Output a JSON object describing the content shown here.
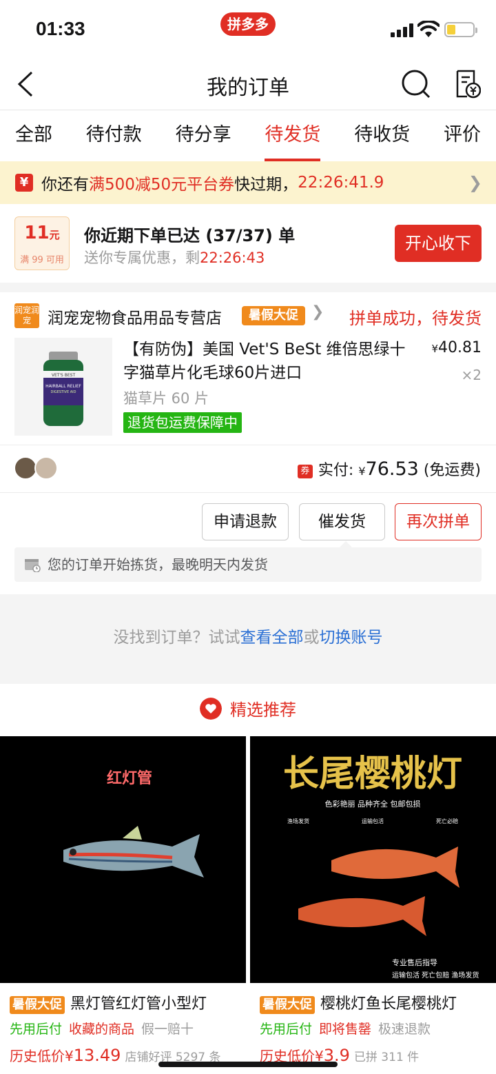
{
  "status_bar": {
    "time": "01:33",
    "brand_badge": "拼多多"
  },
  "nav": {
    "title": "我的订单"
  },
  "tabs": [
    {
      "label": "全部",
      "active": false
    },
    {
      "label": "待付款",
      "active": false
    },
    {
      "label": "待分享",
      "active": false
    },
    {
      "label": "待发货",
      "active": true
    },
    {
      "label": "待收货",
      "active": false
    },
    {
      "label": "评价",
      "active": false
    }
  ],
  "coupon_banner": {
    "prefix": "你还有",
    "highlight": "满500减50元平台券",
    "suffix": "快过期，",
    "countdown": "22:26:41.9"
  },
  "promo": {
    "coupon_amount": "11",
    "coupon_unit": "元",
    "coupon_condition": "满 99 可用",
    "headline": "你近期下单已达 (37/37) 单",
    "sub_prefix": "送你专属优惠，剩",
    "sub_timer": "22:26:43",
    "button_label": "开心收下"
  },
  "order": {
    "shop_logo_text": "润宠润宠",
    "shop_name": "润宠宠物食品用品专营店",
    "shop_tag": "暑假大促",
    "status": "拼单成功，待发货",
    "item_title": "【有防伪】美国 Vet'S BeSt 维倍思绿十字猫草片化毛球60片进口",
    "item_price": "40.81",
    "item_currency": "¥",
    "item_qty": "×2",
    "item_spec": "猫草片 60 片",
    "guarantee": "退货包运费保障中",
    "pay_coupon_icon": "券",
    "pay_label": "实付:",
    "pay_currency": "¥",
    "pay_amount": "76.53",
    "pay_note": "(免运费)",
    "actions": [
      "申请退款",
      "催发货",
      "再次拼单"
    ],
    "notice": "您的订单开始拣货，最晚明天内发货"
  },
  "empty_hint": {
    "prefix": "没找到订单？试试",
    "link1": "查看全部",
    "middle": "或",
    "link2": "切换账号"
  },
  "recommend": {
    "title": "精选推荐",
    "cards": [
      {
        "image_text": "红灯管",
        "tag": "暑假大促",
        "title": "黑灯管红灯管小型灯",
        "badge": "先用后付",
        "label_red": "收藏的商品",
        "label_gray": "假一赔十",
        "price_label": "历史低价",
        "currency": "¥",
        "price": "13.49",
        "meta": "店铺好评 5297 条"
      },
      {
        "image_text": "长尾樱桃灯",
        "image_sub": "色彩艳丽 品种齐全 包邮包损",
        "image_row": [
          "渔场发货",
          "运输包活",
          "死亡必赔"
        ],
        "image_foot1": "专业售后指导",
        "image_foot2": "运输包活 死亡包赔 渔场发货",
        "tag": "暑假大促",
        "title": "樱桃灯鱼长尾樱桃灯",
        "badge": "先用后付",
        "label_red": "即将售罄",
        "label_gray": "极速退款",
        "price_label": "历史低价",
        "currency": "¥",
        "price": "3.9",
        "meta": "已拼 311 件"
      }
    ]
  },
  "colors": {
    "brand_red": "#e02e24",
    "green": "#25b513",
    "orange": "#f08a1c",
    "link_blue": "#2a6fd4"
  }
}
